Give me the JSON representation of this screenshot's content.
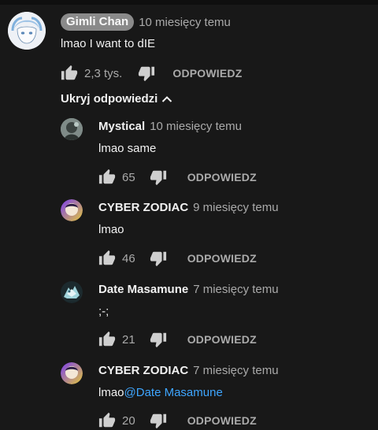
{
  "top_comment": {
    "author": "Gimli Chan",
    "time": "10 miesięcy temu",
    "text": "lmao I want to dIE",
    "likes": "2,3 tys.",
    "reply_label": "ODPOWIEDZ"
  },
  "hide_replies_label": "Ukryj odpowiedzi",
  "replies": [
    {
      "author": "Mystical",
      "time": "10 miesięcy temu",
      "text": "lmao same",
      "likes": "65",
      "reply_label": "ODPOWIEDZ"
    },
    {
      "author": "CYBER ZODIAC",
      "time": "9 miesięcy temu",
      "text": "lmao",
      "likes": "46",
      "reply_label": "ODPOWIEDZ"
    },
    {
      "author": "Date Masamune",
      "time": "7 miesięcy temu",
      "text": ";-;",
      "likes": "21",
      "reply_label": "ODPOWIEDZ"
    },
    {
      "author": "CYBER ZODIAC",
      "time": "7 miesięcy temu",
      "text": "lmao",
      "mention": "@Date Masamune",
      "likes": "20",
      "reply_label": "ODPOWIEDZ"
    }
  ],
  "icons": {
    "like": "thumb-up-icon",
    "dislike": "thumb-down-icon",
    "collapse": "chevron-up-icon"
  },
  "colors": {
    "background": "#181818",
    "text": "#f1f1f1",
    "secondary": "#aaaaaa",
    "mention": "#3ea6ff",
    "author_badge": "#8a8a8a"
  }
}
